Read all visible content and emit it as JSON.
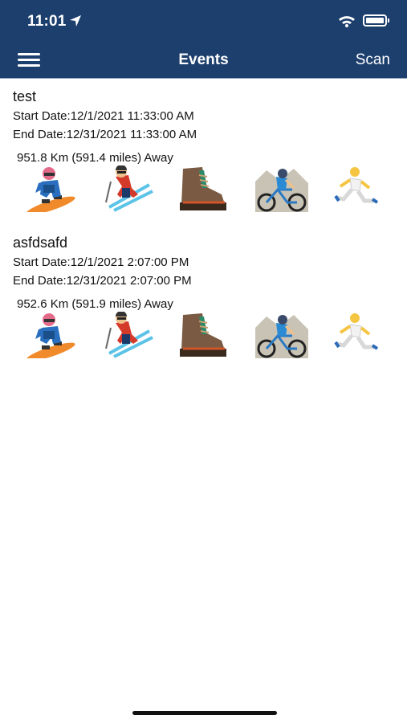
{
  "status_bar": {
    "time": "11:01",
    "icons": [
      "location-arrow-icon",
      "wifi-icon",
      "battery-icon"
    ]
  },
  "nav": {
    "menu_icon": "hamburger-menu-icon",
    "title": "Events",
    "scan_label": "Scan"
  },
  "colors": {
    "header_bg": "#1d3f6e",
    "header_text": "#ffffff",
    "body_bg": "#ffffff"
  },
  "events": [
    {
      "name": "test",
      "start": "Start Date:12/1/2021 11:33:00 AM",
      "end": "End Date:12/31/2021 11:33:00 AM",
      "distance": "951.8 Km (591.4 miles) Away",
      "activities": [
        "snowboarder-icon",
        "skier-icon",
        "hiking-boot-icon",
        "mountain-biker-icon",
        "runner-icon"
      ]
    },
    {
      "name": "asfdsafd",
      "start": "Start Date:12/1/2021 2:07:00 PM",
      "end": "End Date:12/31/2021 2:07:00 PM",
      "distance": "952.6 Km (591.9 miles) Away",
      "activities": [
        "snowboarder-icon",
        "skier-icon",
        "hiking-boot-icon",
        "mountain-biker-icon",
        "runner-icon"
      ]
    }
  ]
}
